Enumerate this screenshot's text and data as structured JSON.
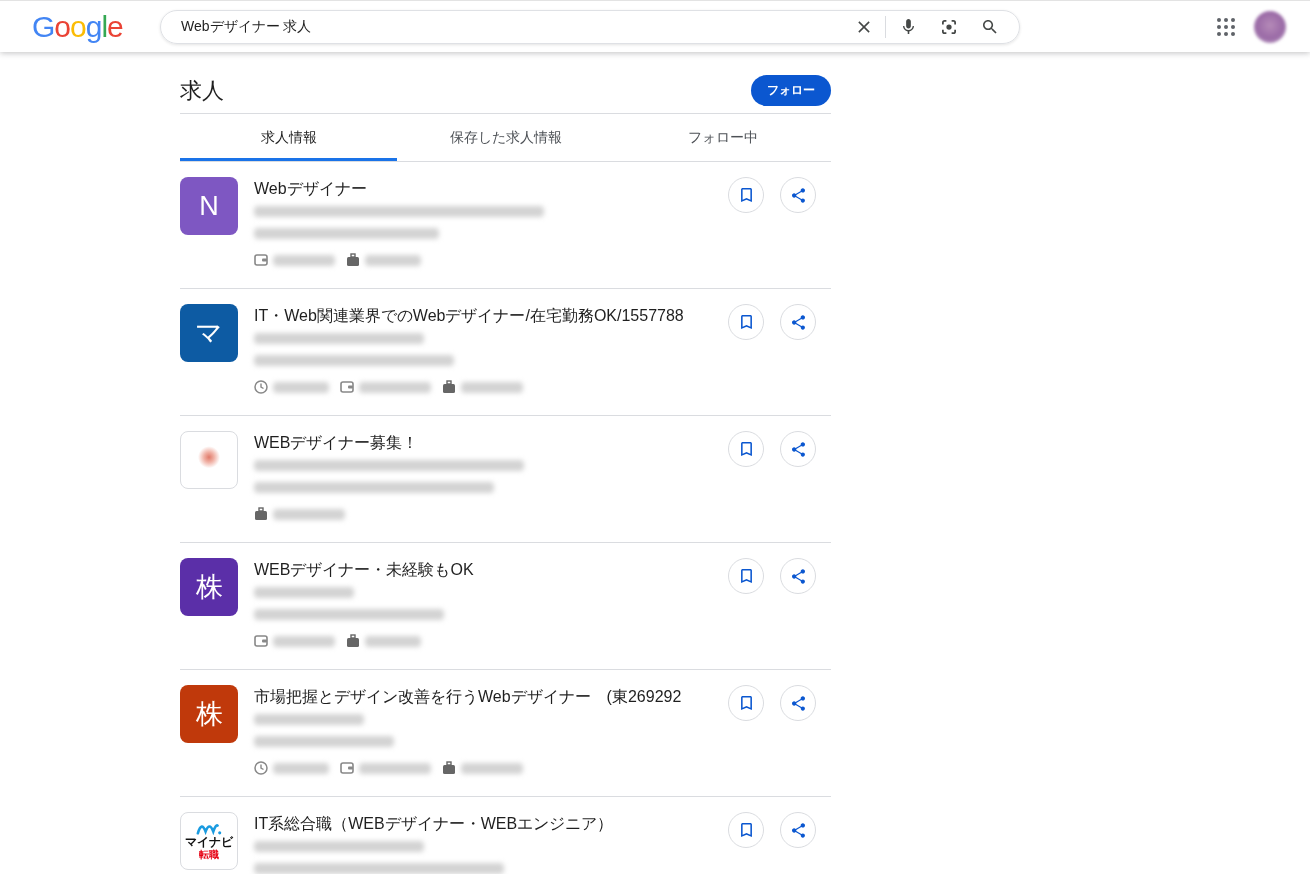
{
  "header": {
    "logo": "Google",
    "search": {
      "value": "Webデザイナー 求人"
    }
  },
  "panel": {
    "title": "求人",
    "follow_button": "フォロー",
    "tabs": [
      {
        "label": "求人情報",
        "selected": true
      },
      {
        "label": "保存した求人情報",
        "selected": false
      },
      {
        "label": "フォロー中",
        "selected": false
      }
    ],
    "jobs": [
      {
        "title": "Webデザイナー",
        "logo": {
          "kind": "letter",
          "text": "N",
          "color": "#7e57c2"
        },
        "blurred_lines": [
          {
            "kind": "text"
          },
          {
            "kind": "text"
          },
          {
            "kind": "meta",
            "icons": [
              {
                "kind": "wallet"
              },
              {
                "kind": "bag"
              }
            ]
          }
        ]
      },
      {
        "title": "IT・Web関連業界でのWebデザイナー/在宅勤務OK/1557788",
        "logo": {
          "kind": "letter",
          "text": "マ",
          "color": "#0d5ba3"
        },
        "blurred_lines": [
          {
            "kind": "text"
          },
          {
            "kind": "text"
          },
          {
            "kind": "meta",
            "icons": [
              {
                "kind": "clock"
              },
              {
                "kind": "wallet"
              },
              {
                "kind": "bag"
              }
            ]
          }
        ]
      },
      {
        "title": "WEBデザイナー募集！",
        "logo": {
          "kind": "blurred"
        },
        "blurred_lines": [
          {
            "kind": "text"
          },
          {
            "kind": "text"
          },
          {
            "kind": "meta",
            "icons": [
              {
                "kind": "bag"
              }
            ]
          }
        ]
      },
      {
        "title": "WEBデザイナー・未経験もOK",
        "logo": {
          "kind": "letter",
          "text": "株",
          "color": "#5b2fa8"
        },
        "blurred_lines": [
          {
            "kind": "text"
          },
          {
            "kind": "text"
          },
          {
            "kind": "meta",
            "icons": [
              {
                "kind": "wallet"
              },
              {
                "kind": "bag"
              }
            ]
          }
        ]
      },
      {
        "title": "市場把握とデザイン改善を行うWebデザイナー　(東269292",
        "logo": {
          "kind": "letter",
          "text": "株",
          "color": "#c0390b"
        },
        "blurred_lines": [
          {
            "kind": "text"
          },
          {
            "kind": "text"
          },
          {
            "kind": "meta",
            "icons": [
              {
                "kind": "clock"
              },
              {
                "kind": "wallet"
              },
              {
                "kind": "bag"
              }
            ]
          }
        ]
      },
      {
        "title": "IT系総合職（WEBデザイナー・WEBエンジニア）",
        "logo": {
          "kind": "brand",
          "name": "マイナビ",
          "sub": "転職"
        },
        "blurred_lines": [
          {
            "kind": "text"
          },
          {
            "kind": "text"
          }
        ]
      }
    ]
  }
}
